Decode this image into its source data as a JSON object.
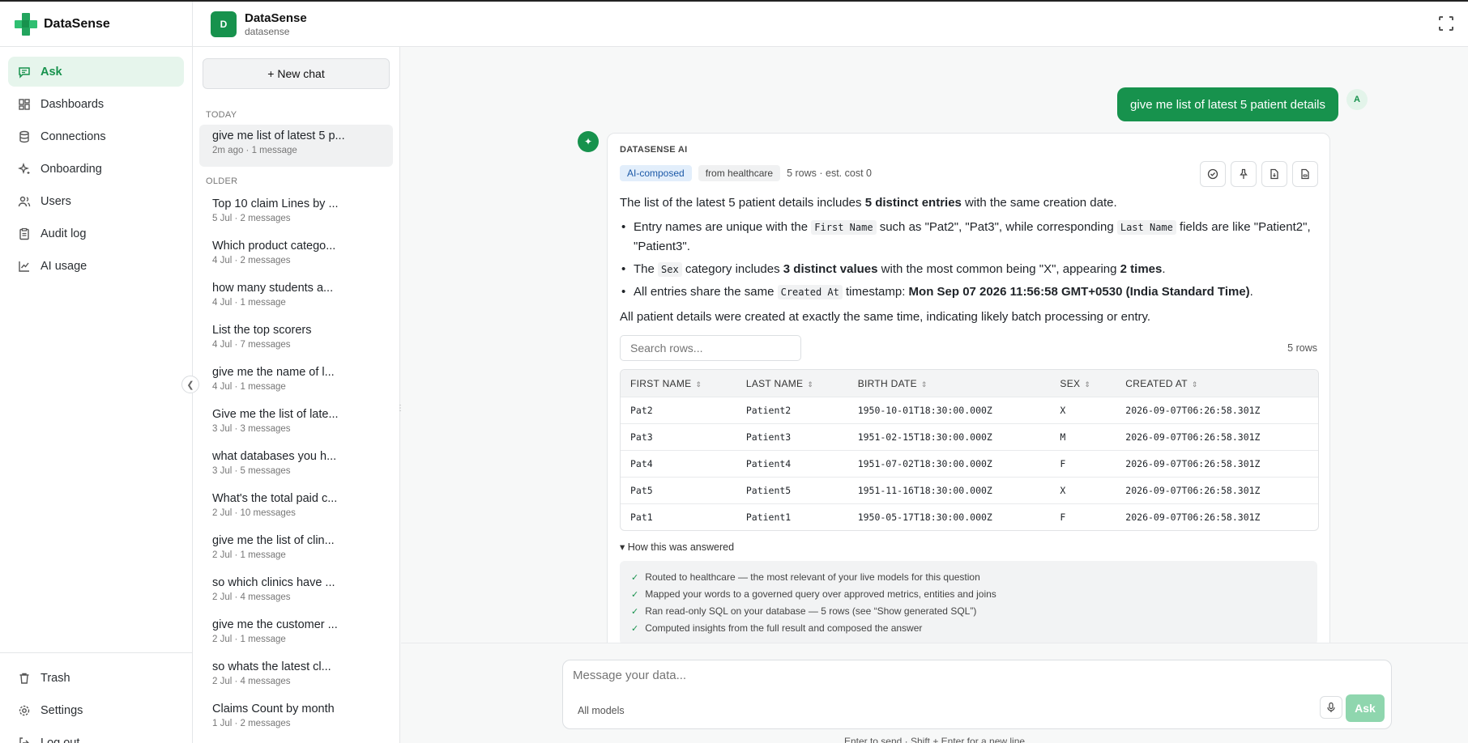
{
  "brand": {
    "name": "DataSense"
  },
  "nav": {
    "items": [
      {
        "label": "Ask",
        "icon": "chat-icon",
        "active": true
      },
      {
        "label": "Dashboards",
        "icon": "dashboard-icon"
      },
      {
        "label": "Connections",
        "icon": "database-icon"
      },
      {
        "label": "Onboarding",
        "icon": "sparkle-icon"
      },
      {
        "label": "Users",
        "icon": "users-icon"
      },
      {
        "label": "Audit log",
        "icon": "clipboard-icon"
      },
      {
        "label": "AI usage",
        "icon": "chart-line-icon"
      }
    ],
    "bottom": [
      {
        "label": "Trash",
        "icon": "trash-icon"
      },
      {
        "label": "Settings",
        "icon": "gear-icon"
      },
      {
        "label": "Log out",
        "icon": "logout-icon"
      }
    ]
  },
  "workspace": {
    "initial": "D",
    "name": "DataSense",
    "sub": "datasense"
  },
  "chatlist": {
    "new_chat": "+ New chat",
    "today_label": "TODAY",
    "older_label": "OLDER",
    "today": [
      {
        "title": "give me list of latest 5 p...",
        "meta": "2m ago · 1 message"
      }
    ],
    "older": [
      {
        "title": "Top 10 claim Lines by ...",
        "meta": "5 Jul · 2 messages"
      },
      {
        "title": "Which product catego...",
        "meta": "4 Jul · 2 messages"
      },
      {
        "title": "how many students a...",
        "meta": "4 Jul · 1 message"
      },
      {
        "title": "List the top scorers",
        "meta": "4 Jul · 7 messages"
      },
      {
        "title": "give me the name of l...",
        "meta": "4 Jul · 1 message"
      },
      {
        "title": "Give me the list of late...",
        "meta": "3 Jul · 3 messages"
      },
      {
        "title": "what databases you h...",
        "meta": "3 Jul · 5 messages"
      },
      {
        "title": "What's the total paid c...",
        "meta": "2 Jul · 10 messages"
      },
      {
        "title": "give me the list of clin...",
        "meta": "2 Jul · 1 message"
      },
      {
        "title": "so which clinics have ...",
        "meta": "2 Jul · 4 messages"
      },
      {
        "title": "give me the customer ...",
        "meta": "2 Jul · 1 message"
      },
      {
        "title": "so whats the latest cl...",
        "meta": "2 Jul · 4 messages"
      },
      {
        "title": "Claims Count by month",
        "meta": "1 Jul · 2 messages"
      }
    ]
  },
  "conversation": {
    "user_message": "give me list of latest 5 patient details",
    "user_initial": "A",
    "ai": {
      "label": "DATASENSE AI",
      "tag_composed": "AI-composed",
      "tag_source": "from healthcare",
      "stats": "5 rows · est. cost 0",
      "summary_pre": "The list of the latest 5 patient details includes ",
      "summary_bold": "5 distinct entries",
      "summary_post": " with the same creation date.",
      "b1_a": "Entry names are unique with the ",
      "b1_code1": "First Name",
      "b1_b": " such as \"Pat2\", \"Pat3\", while corresponding ",
      "b1_code2": "Last Name",
      "b1_c": " fields are like \"Patient2\", \"Patient3\".",
      "b2_a": "The ",
      "b2_code": "Sex",
      "b2_b": " category includes ",
      "b2_bold1": "3 distinct values",
      "b2_c": " with the most common being \"X\", appearing ",
      "b2_bold2": "2 times",
      "b2_d": ".",
      "b3_a": "All entries share the same ",
      "b3_code": "Created At",
      "b3_b": " timestamp: ",
      "b3_bold": "Mon Sep 07 2026 11:56:58 GMT+0530 (India Standard Time)",
      "b3_c": ".",
      "conclusion": "All patient details were created at exactly the same time, indicating likely batch processing or entry.",
      "search_placeholder": "Search rows...",
      "row_count": "5 rows",
      "columns": [
        "FIRST NAME",
        "LAST NAME",
        "BIRTH DATE",
        "SEX",
        "CREATED AT"
      ],
      "rows": [
        [
          "Pat2",
          "Patient2",
          "1950-10-01T18:30:00.000Z",
          "X",
          "2026-09-07T06:26:58.301Z"
        ],
        [
          "Pat3",
          "Patient3",
          "1951-02-15T18:30:00.000Z",
          "M",
          "2026-09-07T06:26:58.301Z"
        ],
        [
          "Pat4",
          "Patient4",
          "1951-07-02T18:30:00.000Z",
          "F",
          "2026-09-07T06:26:58.301Z"
        ],
        [
          "Pat5",
          "Patient5",
          "1951-11-16T18:30:00.000Z",
          "X",
          "2026-09-07T06:26:58.301Z"
        ],
        [
          "Pat1",
          "Patient1",
          "1950-05-17T18:30:00.000Z",
          "F",
          "2026-09-07T06:26:58.301Z"
        ]
      ],
      "how_label": "How this was answered",
      "steps": [
        "Routed to healthcare — the most relevant of your live models for this question",
        "Mapped your words to a governed query over approved metrics, entities and joins",
        "Ran read-only SQL on your database — 5 rows (see “Show generated SQL”)",
        "Computed insights from the full result and composed the answer"
      ]
    }
  },
  "composer": {
    "placeholder": "Message your data...",
    "models": "All models",
    "ask": "Ask",
    "hint": "Enter to send · Shift + Enter for a new line"
  },
  "colors": {
    "accent": "#17924d",
    "accent_light": "#e6f5ec",
    "ask_disabled": "#8fd6ae"
  }
}
